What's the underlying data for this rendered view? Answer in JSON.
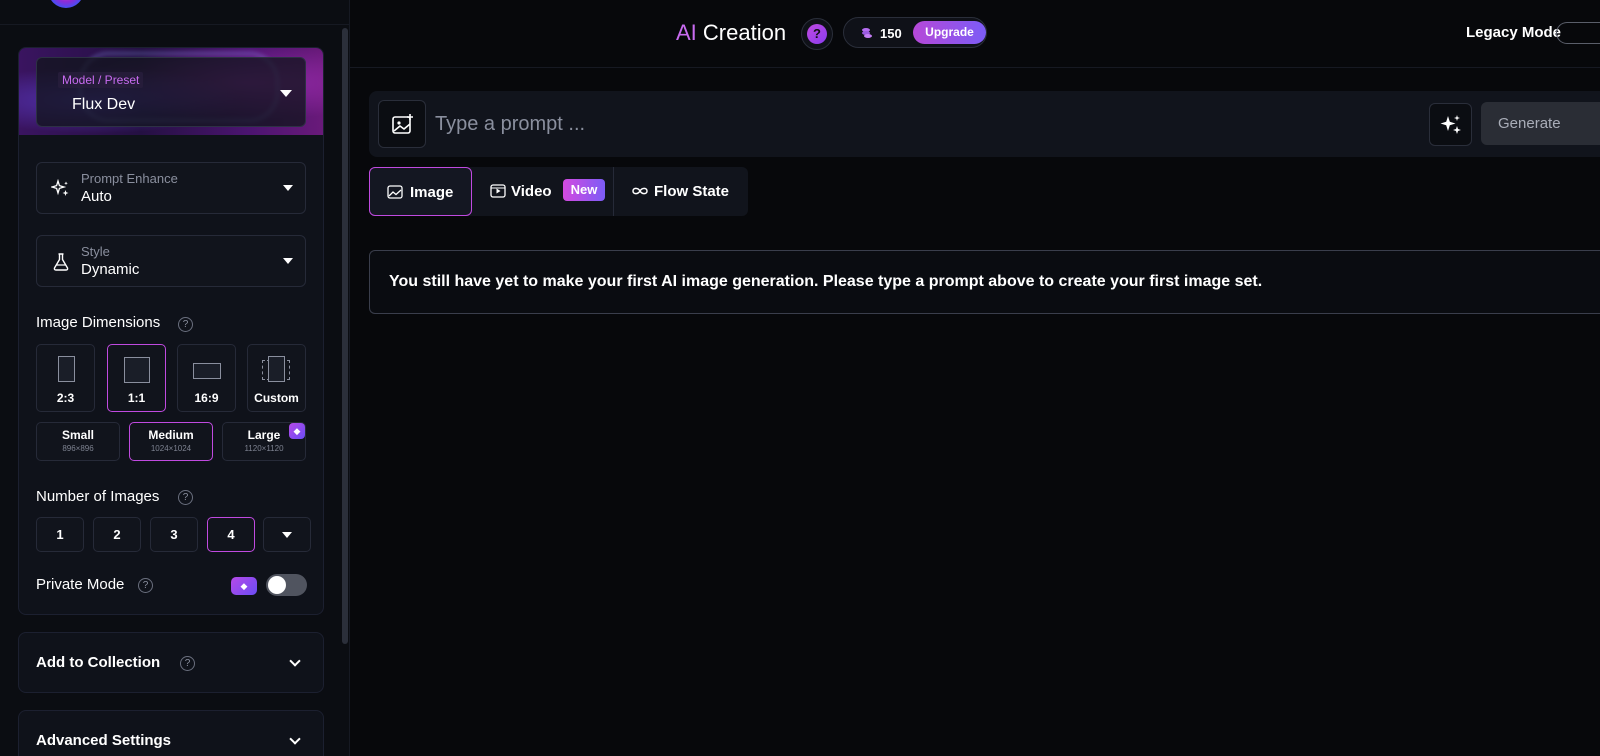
{
  "sidebar": {
    "model": {
      "kicker": "Model / Preset",
      "value": "Flux Dev"
    },
    "prompt_enhance": {
      "kicker": "Prompt Enhance",
      "value": "Auto"
    },
    "style": {
      "kicker": "Style",
      "value": "Dynamic"
    },
    "image_dimensions": {
      "label": "Image Dimensions",
      "ratios": [
        {
          "label": "2:3",
          "selected": false
        },
        {
          "label": "1:1",
          "selected": true
        },
        {
          "label": "16:9",
          "selected": false
        },
        {
          "label": "Custom",
          "selected": false
        }
      ],
      "sizes": [
        {
          "label": "Small",
          "sub": "896×896",
          "selected": false
        },
        {
          "label": "Medium",
          "sub": "1024×1024",
          "selected": true
        },
        {
          "label": "Large",
          "sub": "1120×1120",
          "selected": false,
          "premium": true
        }
      ]
    },
    "number_of_images": {
      "label": "Number of Images",
      "options": [
        "1",
        "2",
        "3",
        "4"
      ],
      "selected": "4"
    },
    "private_mode": {
      "label": "Private Mode",
      "enabled": false
    },
    "add_to_collection": {
      "label": "Add to Collection"
    },
    "advanced_settings": {
      "label": "Advanced Settings"
    }
  },
  "header": {
    "title_ai": "AI",
    "title_rest": " Creation",
    "help": "?",
    "credits": "150",
    "upgrade_label": "Upgrade",
    "legacy_label": "Legacy Mode"
  },
  "prompt": {
    "placeholder": "Type a prompt ...",
    "value": "",
    "generate_label": "Generate"
  },
  "tabs": [
    {
      "label": "Image",
      "icon": "image-icon",
      "active": true
    },
    {
      "label": "Video",
      "icon": "video-icon",
      "badge": "New",
      "active": false
    },
    {
      "label": "Flow State",
      "icon": "infinity-icon",
      "active": false
    }
  ],
  "notice": "You still have yet to make your first AI image generation. Please type a prompt above to create your first image set.",
  "colors": {
    "accent": "#c04ae0",
    "accent_gradient_end": "#7c5cf6",
    "background": "#07080b",
    "panel": "#0f121a"
  }
}
